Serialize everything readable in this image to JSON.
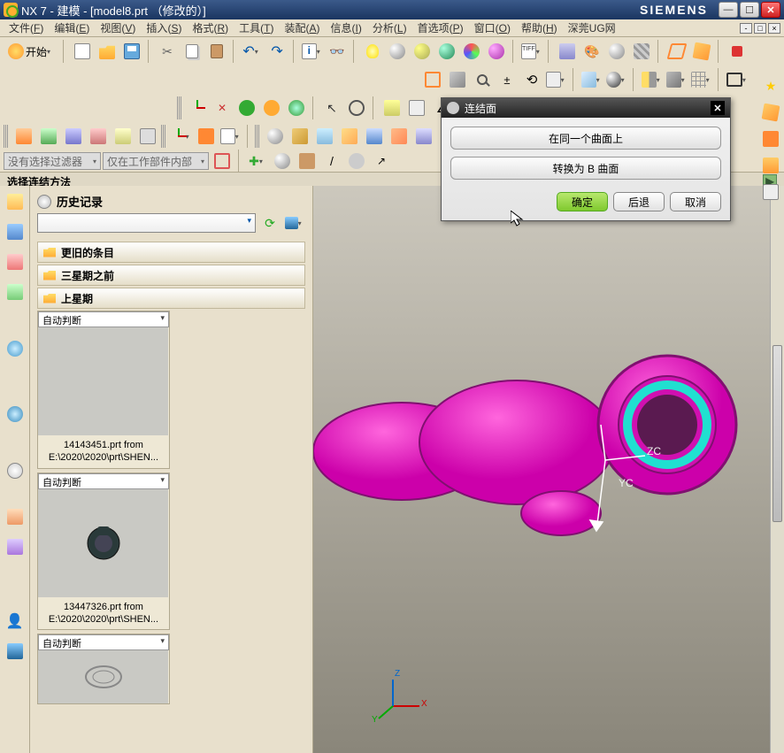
{
  "title": "NX 7 - 建模 - [model8.prt （修改的）]",
  "brand": "SIEMENS",
  "menu": [
    {
      "label": "文件",
      "hotkey": "F"
    },
    {
      "label": "编辑",
      "hotkey": "E"
    },
    {
      "label": "视图",
      "hotkey": "V"
    },
    {
      "label": "插入",
      "hotkey": "S"
    },
    {
      "label": "格式",
      "hotkey": "R"
    },
    {
      "label": "工具",
      "hotkey": "T"
    },
    {
      "label": "装配",
      "hotkey": "A"
    },
    {
      "label": "信息",
      "hotkey": "I"
    },
    {
      "label": "分析",
      "hotkey": "L"
    },
    {
      "label": "首选项",
      "hotkey": "P"
    },
    {
      "label": "窗口",
      "hotkey": "O"
    },
    {
      "label": "帮助",
      "hotkey": "H"
    },
    {
      "label": "深莞UG网",
      "hotkey": ""
    }
  ],
  "start_label": "开始",
  "tiff_label": "TIFF",
  "filter1": "没有选择过滤器",
  "filter2": "仅在工作部件内部",
  "status": "选择连结方法",
  "history_title": "历史记录",
  "folders": [
    "更旧的条目",
    "三星期之前",
    "上星期"
  ],
  "auto_infer": "自动判断",
  "thumbs": [
    {
      "caption": "14143451.prt from E:\\2020\\2020\\prt\\SHEN..."
    },
    {
      "caption": "13447326.prt from E:\\2020\\2020\\prt\\SHEN..."
    }
  ],
  "dialog": {
    "title": "连结面",
    "opt1": "在同一个曲面上",
    "opt2": "转换为 B 曲面",
    "ok": "确定",
    "back": "后退",
    "cancel": "取消"
  },
  "triad": {
    "x": "X",
    "y": "Y",
    "z": "Z",
    "xc": "XC",
    "yc": "YC",
    "zc": "ZC"
  }
}
